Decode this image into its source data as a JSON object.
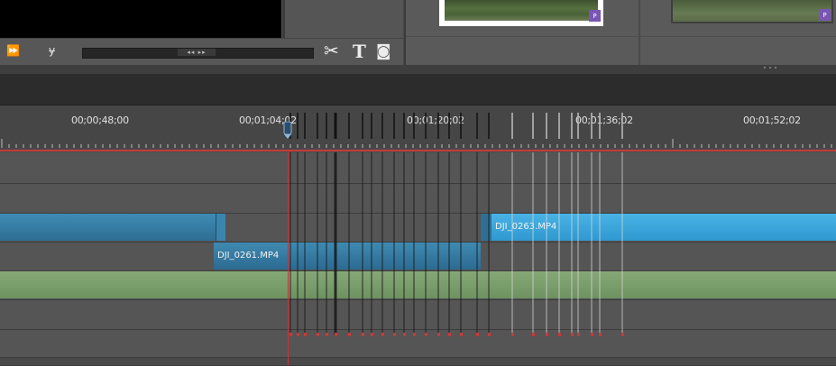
{
  "transport": {
    "buttons": [
      {
        "name": "fast-forward-icon",
        "glyph": "⏩"
      },
      {
        "name": "trim-icon",
        "glyph": "ɏ"
      }
    ],
    "scrub_handle_glyph": "◂◂ ▸▸",
    "tools": [
      {
        "name": "scissors-icon",
        "glyph": "✂"
      },
      {
        "name": "text-tool-icon",
        "glyph": "T"
      },
      {
        "name": "camera-snapshot-icon",
        "glyph": "◙"
      }
    ]
  },
  "media_panel": {
    "badge_label": "P"
  },
  "ruler": {
    "timecodes": [
      "00;00;48;00",
      "00;01;04;02",
      "00;01;20;02",
      "00;01;36;02",
      "00;01;52;02"
    ]
  },
  "timeline": {
    "clips": [
      {
        "id": "DJI_0261.MP4",
        "label": "DJI_0261.MP4"
      },
      {
        "id": "DJI_0263.MP4",
        "label": "DJI_0263.MP4"
      }
    ]
  },
  "colors": {
    "playhead": "#d03030",
    "video_clip": "#3f8ab2",
    "selected_clip": "#49b3e6",
    "audio_clip": "#7a9e6c",
    "badge": "#7b55b5"
  }
}
